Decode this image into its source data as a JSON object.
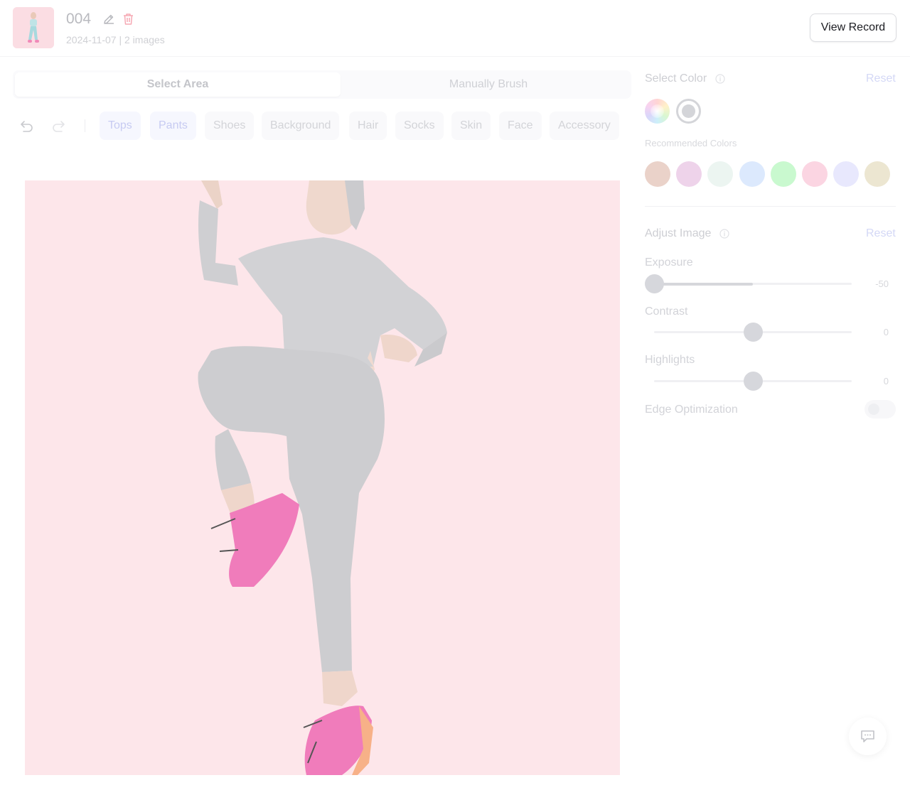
{
  "header": {
    "title": "004",
    "meta": "2024-11-07 | 2 images",
    "view_record_label": "View Record"
  },
  "modes": {
    "active": "Select Area",
    "inactive": "Manually Brush"
  },
  "categories": [
    "Tops",
    "Pants",
    "Shoes",
    "Background",
    "Hair",
    "Socks",
    "Skin",
    "Face",
    "Accessory"
  ],
  "selected_categories": [
    "Tops",
    "Pants"
  ],
  "select_color": {
    "heading": "Select Color",
    "reset_label": "Reset",
    "recommended_label": "Recommended Colors",
    "recommended_colors": [
      "#ead2c9",
      "#eed3ea",
      "#ecf5f1",
      "#dce9fd",
      "#c9f9cf",
      "#fbd5e2",
      "#e8e8fd",
      "#ece6d1"
    ]
  },
  "adjust_image": {
    "heading": "Adjust Image",
    "reset_label": "Reset",
    "exposure": {
      "label": "Exposure",
      "value": "-50"
    },
    "contrast": {
      "label": "Contrast",
      "value": "0"
    },
    "highlights": {
      "label": "Highlights",
      "value": "0"
    },
    "edge_optimization": {
      "label": "Edge Optimization",
      "enabled": false
    }
  },
  "colors": {
    "accent": "#c7cbf2",
    "canvas_background": "#fde7eb",
    "outfit": "#cdcdd0",
    "shoe": "#f07fbb"
  },
  "icons": {
    "edit": "pencil-icon",
    "delete": "trash-icon",
    "undo": "undo-icon",
    "redo": "redo-icon",
    "info": "info-icon",
    "chat": "chat-icon"
  }
}
